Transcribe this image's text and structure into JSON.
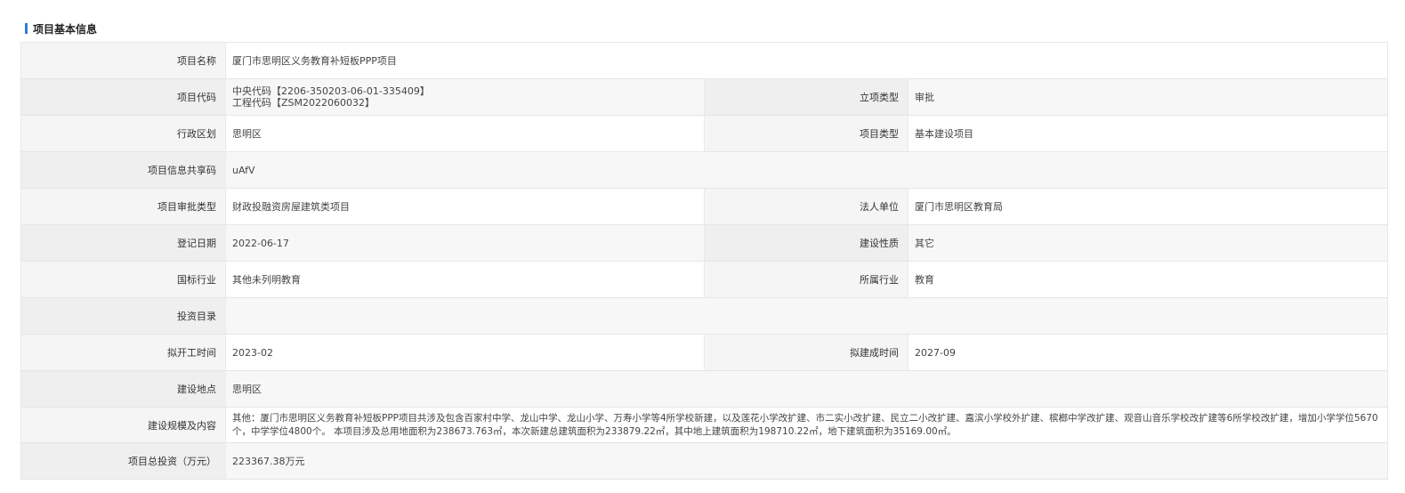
{
  "section": {
    "title": "项目基本信息"
  },
  "fields": {
    "name_label": "项目名称",
    "name_value": "厦门市思明区义务教育补短板PPP项目",
    "code_label": "项目代码",
    "code_line1": "中央代码【2206-350203-06-01-335409】",
    "code_line2": "工程代码【ZSM2022060032】",
    "approval_type_label": "立项类型",
    "approval_type_value": "审批",
    "district_label": "行政区划",
    "district_value": "思明区",
    "project_type_label": "项目类型",
    "project_type_value": "基本建设项目",
    "share_code_label": "项目信息共享码",
    "share_code_value": "uAfV",
    "review_type_label": "项目审批类型",
    "review_type_value": "财政投融资房屋建筑类项目",
    "legal_unit_label": "法人单位",
    "legal_unit_value": "厦门市思明区教育局",
    "reg_date_label": "登记日期",
    "reg_date_value": "2022-06-17",
    "nature_label": "建设性质",
    "nature_value": "其它",
    "industry_label": "国标行业",
    "industry_value": "其他未列明教育",
    "sector_label": "所属行业",
    "sector_value": "教育",
    "catalog_label": "投资目录",
    "catalog_value": "",
    "start_label": "拟开工时间",
    "start_value": "2023-02",
    "finish_label": "拟建成时间",
    "finish_value": "2027-09",
    "location_label": "建设地点",
    "location_value": "思明区",
    "scale_label": "建设规模及内容",
    "scale_value": "其他：厦门市思明区义务教育补短板PPP项目共涉及包含百家村中学、龙山中学、龙山小学、万寿小学等4所学校新建，以及莲花小学改扩建、市二实小改扩建、民立二小改扩建、嘉滨小学校外扩建、槟榔中学改扩建、观音山音乐学校改扩建等6所学校改扩建，增加小学学位5670个，中学学位4800个。 本项目涉及总用地面积为238673.763㎡，本次新建总建筑面积为233879.22㎡，其中地上建筑面积为198710.22㎡，地下建筑面积为35169.00㎡。",
    "investment_label": "项目总投资（万元）",
    "investment_value": "223367.38万元"
  },
  "colors": {
    "accent": "#2f7dd1"
  }
}
